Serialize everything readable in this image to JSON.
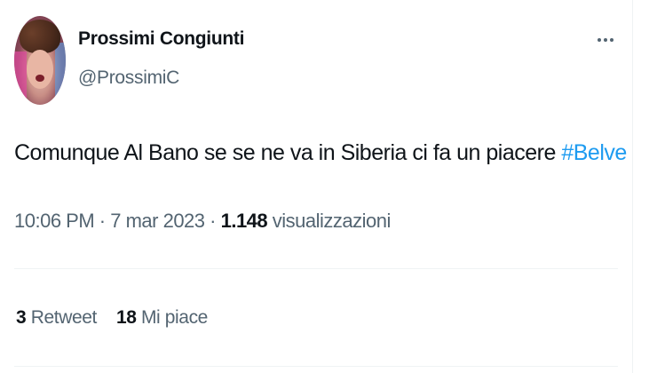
{
  "author": {
    "display_name": "Prossimi Congiunti",
    "handle": "@ProssimiC"
  },
  "tweet": {
    "text": "Comunque Al Bano se se ne va in Siberia ci fa un piacere ",
    "hashtag": "#Belve"
  },
  "meta": {
    "time": "10:06 PM",
    "separator1": " · ",
    "date": "7 mar 2023",
    "separator2": " · ",
    "views_count": "1.148",
    "views_label": " visualizzazioni"
  },
  "stats": {
    "retweets_count": "3",
    "retweets_label": " Retweet",
    "likes_count": "18",
    "likes_label": " Mi piace"
  },
  "icons": {
    "more": "more-horizontal-icon"
  },
  "colors": {
    "text_primary": "#0f1419",
    "text_secondary": "#536471",
    "link": "#1d9bf0",
    "divider": "#eff3f4"
  }
}
